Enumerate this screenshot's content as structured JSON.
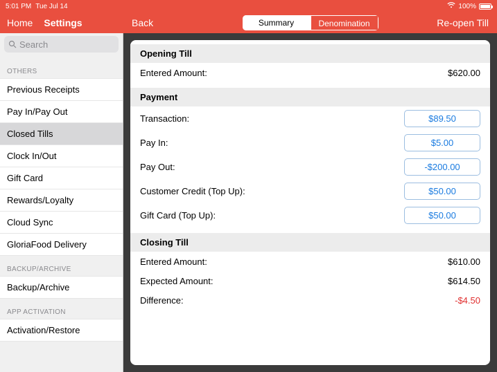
{
  "statusbar": {
    "time": "5:01 PM",
    "date": "Tue Jul 14",
    "battery": "100%"
  },
  "topbar": {
    "home": "Home",
    "settings": "Settings",
    "back": "Back",
    "reopen": "Re-open Till",
    "seg_summary": "Summary",
    "seg_denom": "Denomination"
  },
  "search": {
    "placeholder": "Search"
  },
  "sections": {
    "others": "OTHERS",
    "backup": "BACKUP/ARCHIVE",
    "activation": "APP ACTIVATION"
  },
  "sidebar": {
    "others": [
      "Previous Receipts",
      "Pay In/Pay Out",
      "Closed Tills",
      "Clock In/Out",
      "Gift Card",
      "Rewards/Loyalty",
      "Cloud Sync",
      "GloriaFood Delivery"
    ],
    "backup": [
      "Backup/Archive"
    ],
    "activation": [
      "Activation/Restore"
    ]
  },
  "opening": {
    "header": "Opening Till",
    "entered_label": "Entered Amount:",
    "entered_value": "$620.00"
  },
  "payment": {
    "header": "Payment",
    "rows": [
      {
        "label": "Transaction:",
        "value": "$89.50"
      },
      {
        "label": "Pay In:",
        "value": "$5.00"
      },
      {
        "label": "Pay Out:",
        "value": "-$200.00"
      },
      {
        "label": "Customer Credit (Top Up):",
        "value": "$50.00"
      },
      {
        "label": "Gift Card (Top Up):",
        "value": "$50.00"
      }
    ]
  },
  "closing": {
    "header": "Closing Till",
    "entered_label": "Entered Amount:",
    "entered_value": "$610.00",
    "expected_label": "Expected Amount:",
    "expected_value": "$614.50",
    "diff_label": "Difference:",
    "diff_value": "-$4.50"
  }
}
